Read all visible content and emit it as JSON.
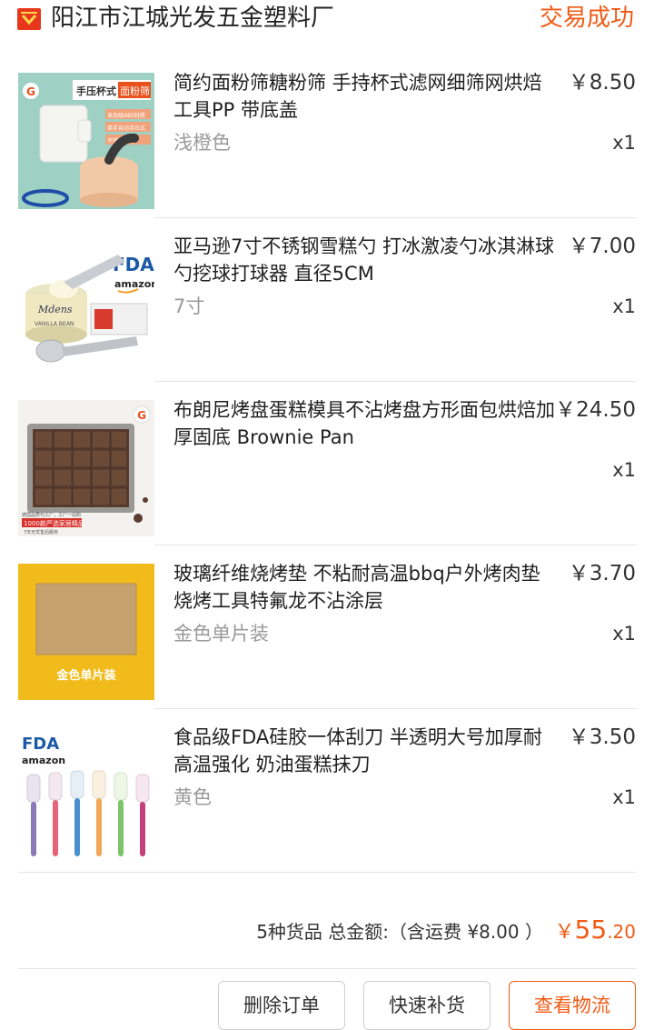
{
  "shop": {
    "name": "阳江市江城光发五金塑料厂",
    "icon": "shop-icon",
    "status": "交易成功",
    "accent": "#f05a14"
  },
  "items": [
    {
      "title": "简约面粉筛糖粉筛 手持杯式滤网细筛网烘焙工具PP 带底盖",
      "spec": "浅橙色",
      "price": "￥8.50",
      "qty": "x1",
      "thumb": {
        "badge": "G",
        "banner": "手压杯式",
        "banner_hl": "面粉筛",
        "lines": [
          "食品级ABS材质",
          "单手自动手压式",
          "不锈钢筛网"
        ]
      }
    },
    {
      "title": "亚马逊7寸不锈钢雪糕勺 打冰激凌勺冰淇淋球勺挖球打球器 直径5CM",
      "spec": "7寸",
      "price": "￥7.00",
      "qty": "x1",
      "thumb": {
        "fda": "FDA",
        "brand": "amazon",
        "tub": "Mdens",
        "tub_sub": "VANILLA BEAN"
      }
    },
    {
      "title": "布朗尼烤盘蛋糕模具不沾烤盘方形面包烘焙加厚固底 Brownie Pan",
      "spec": "",
      "price": "￥24.50",
      "qty": "x1",
      "thumb": {
        "badge": "G",
        "caption1": "德国品质代工厂，工厂一站购",
        "caption2": "1000款严选家居精品",
        "caption3": "7天无忧售后服务"
      }
    },
    {
      "title": "玻璃纤维烧烤垫 不粘耐高温bbq户外烤肉垫烧烤工具特氟龙不沾涂层",
      "spec": "金色单片装",
      "price": "￥3.70",
      "qty": "x1",
      "thumb": {
        "label": "金色单片装"
      }
    },
    {
      "title": "食品级FDA硅胶一体刮刀 半透明大号加厚耐高温强化 奶油蛋糕抹刀",
      "spec": "黄色",
      "price": "￥3.50",
      "qty": "x1",
      "thumb": {
        "fda": "FDA",
        "brand": "amazon"
      }
    }
  ],
  "summary": {
    "label": "5种货品 总金额:（含运费 ¥8.00 ）",
    "currency": "￥",
    "total_int": "55",
    "total_dec": ".20"
  },
  "buttons": {
    "delete": "删除订单",
    "restock": "快速补货",
    "logistics": "查看物流"
  }
}
